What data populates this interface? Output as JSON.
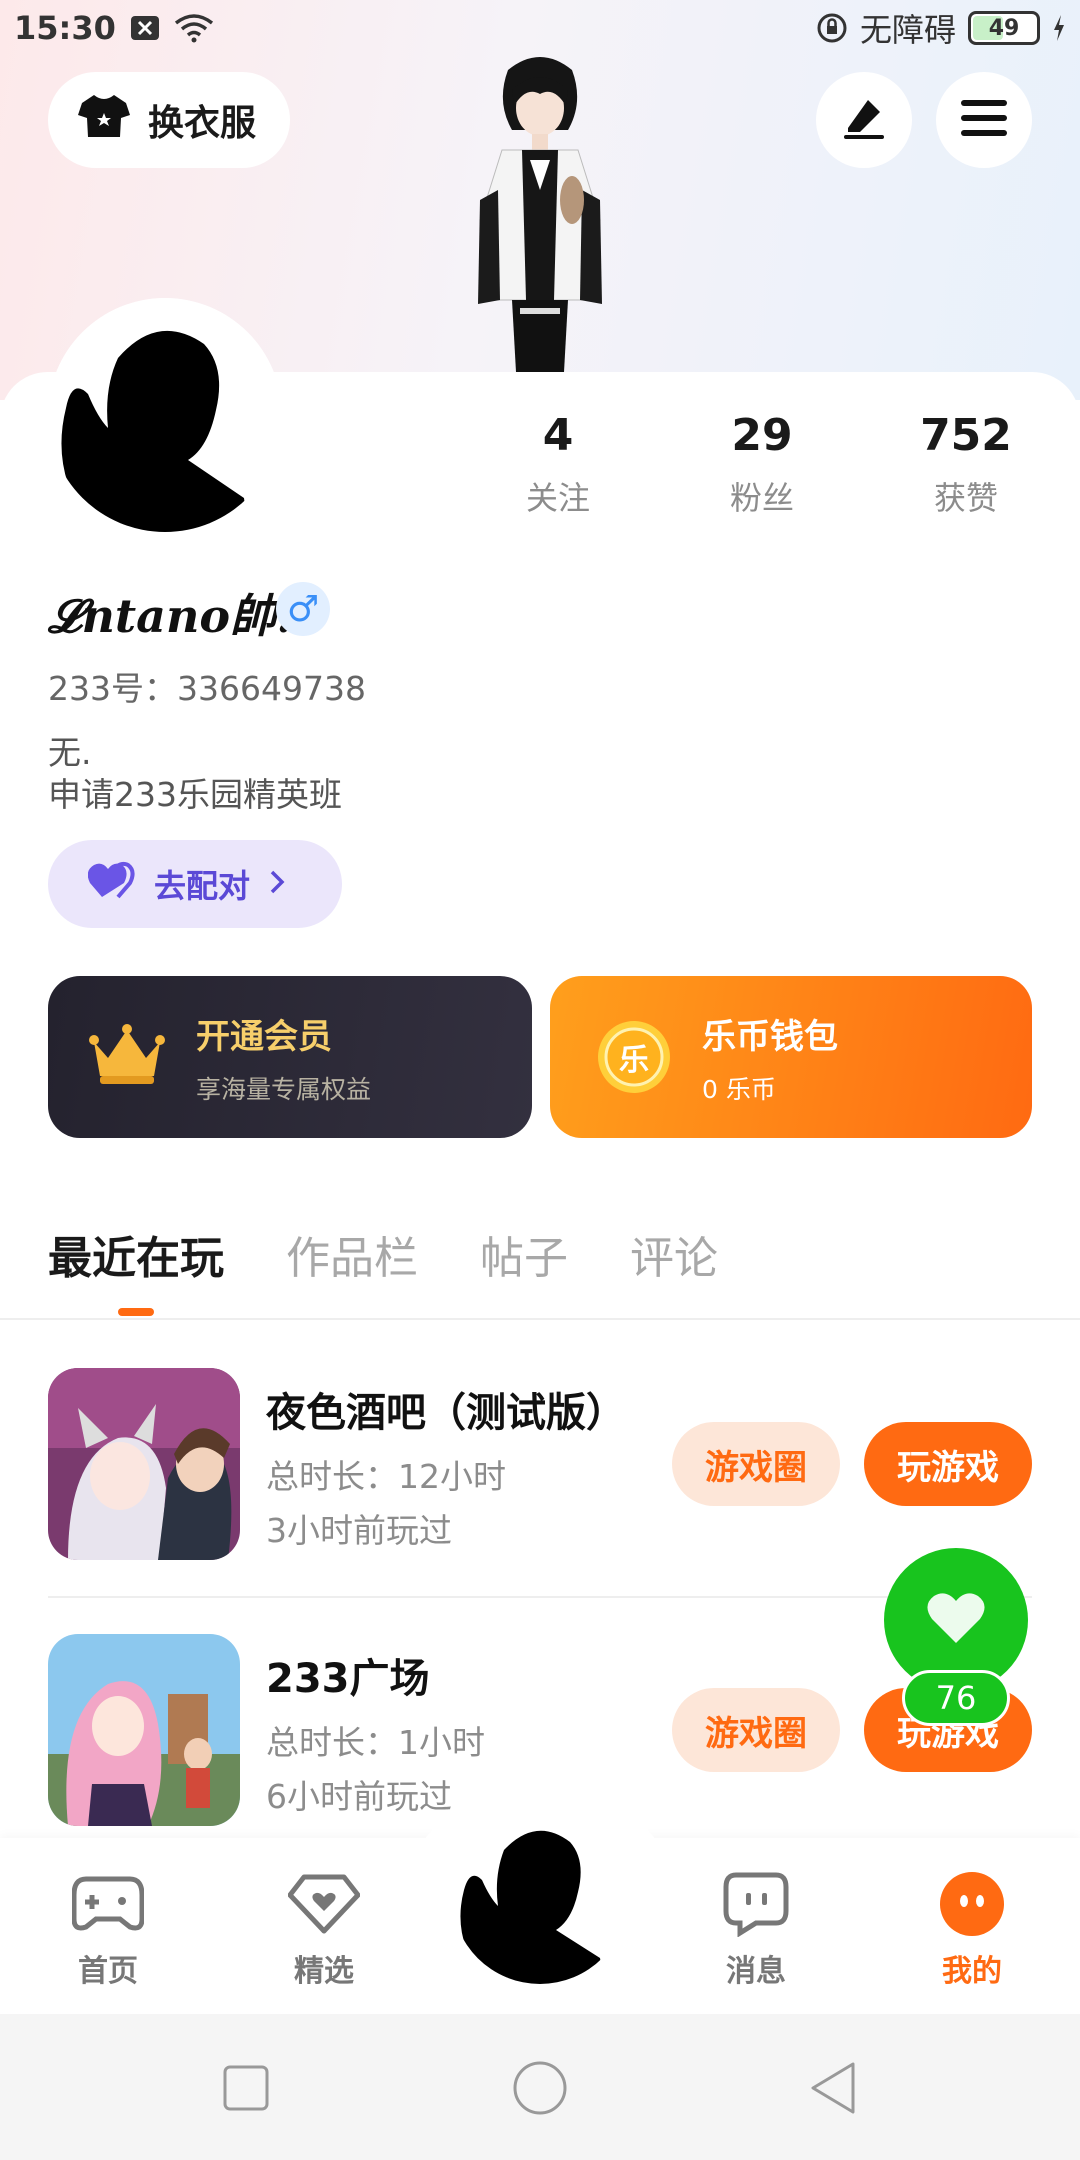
{
  "status_bar": {
    "time": "15:30",
    "accessibility": "无障碍",
    "battery": "49",
    "icons": [
      "close-box-icon",
      "wifi-icon",
      "lock-rotation-icon",
      "charging-icon"
    ]
  },
  "top": {
    "outfit_label": "换衣服",
    "edit_icon": "pen-icon",
    "menu_icon": "hamburger-menu-icon"
  },
  "profile": {
    "stats": [
      {
        "value": "4",
        "label": "关注"
      },
      {
        "value": "29",
        "label": "粉丝"
      },
      {
        "value": "752",
        "label": "获赞"
      }
    ],
    "username": "𝓛ntano帥.",
    "gender_symbol": "♂",
    "user_id": "233号：336649738",
    "bio_line1": "无.",
    "bio_line2": "申请233乐园精英班",
    "match_label": "去配对"
  },
  "cards": {
    "vip_title": "开通会员",
    "vip_sub": "享海量专属权益",
    "coin_badge": "乐",
    "coin_title": "乐币钱包",
    "coin_sub": "0 乐币"
  },
  "tabs": [
    "最近在玩",
    "作品栏",
    "帖子",
    "评论"
  ],
  "games": [
    {
      "name": "夜色酒吧（测试版）",
      "duration": "总时长：12小时",
      "last_played": "3小时前玩过",
      "circle_label": "游戏圈",
      "play_label": "玩游戏"
    },
    {
      "name": "233广场",
      "duration": "总时长：1小时",
      "last_played": "6小时前玩过",
      "circle_label": "游戏圈",
      "play_label": "玩游戏"
    }
  ],
  "like": {
    "count": "76"
  },
  "bottom_nav": [
    {
      "label": "首页",
      "icon": "gamepad-icon"
    },
    {
      "label": "精选",
      "icon": "heart-gem-icon"
    },
    {
      "label": "消息",
      "icon": "chat-bubble-icon"
    },
    {
      "label": "我的",
      "icon": "smiley-profile-icon"
    }
  ],
  "colors": {
    "accent": "#ff6a12",
    "like_green": "#18c41e",
    "match_purple": "#5b49d6"
  }
}
